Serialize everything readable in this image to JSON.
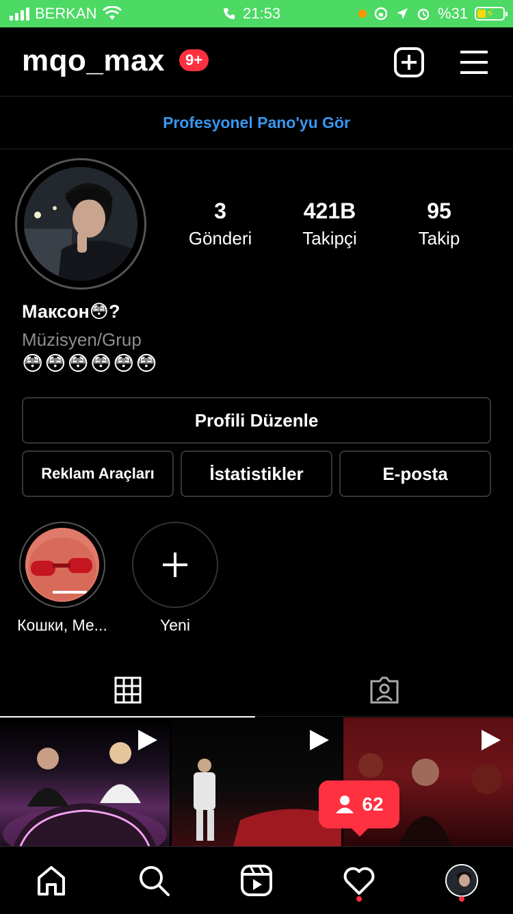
{
  "status_bar": {
    "carrier": "BERKAN",
    "time": "21:53",
    "battery": "%31"
  },
  "header": {
    "username": "mqo_max",
    "notification_badge": "9+"
  },
  "pro_dashboard": {
    "label": "Profesyonel Pano'yu Gör"
  },
  "profile": {
    "stats": [
      {
        "value": "3",
        "label": "Gönderi"
      },
      {
        "value": "421B",
        "label": "Takipçi"
      },
      {
        "value": "95",
        "label": "Takip"
      }
    ],
    "display_name": "Максон😳?",
    "category": "Müzisyen/Grup",
    "bio": "😳😳😳😳😳😳"
  },
  "buttons": {
    "edit_profile": "Profili Düzenle",
    "ad_tools": "Reklam Araçları",
    "insights": "İstatistikler",
    "email": "E-posta"
  },
  "highlights": [
    {
      "label": "Кошки, Ме..."
    },
    {
      "label": "Yeni"
    }
  ],
  "notification_popup": {
    "count": "62"
  },
  "colors": {
    "status_bar_bg": "#4cd964",
    "accent_link": "#3897f0",
    "badge": "#ff3040"
  }
}
